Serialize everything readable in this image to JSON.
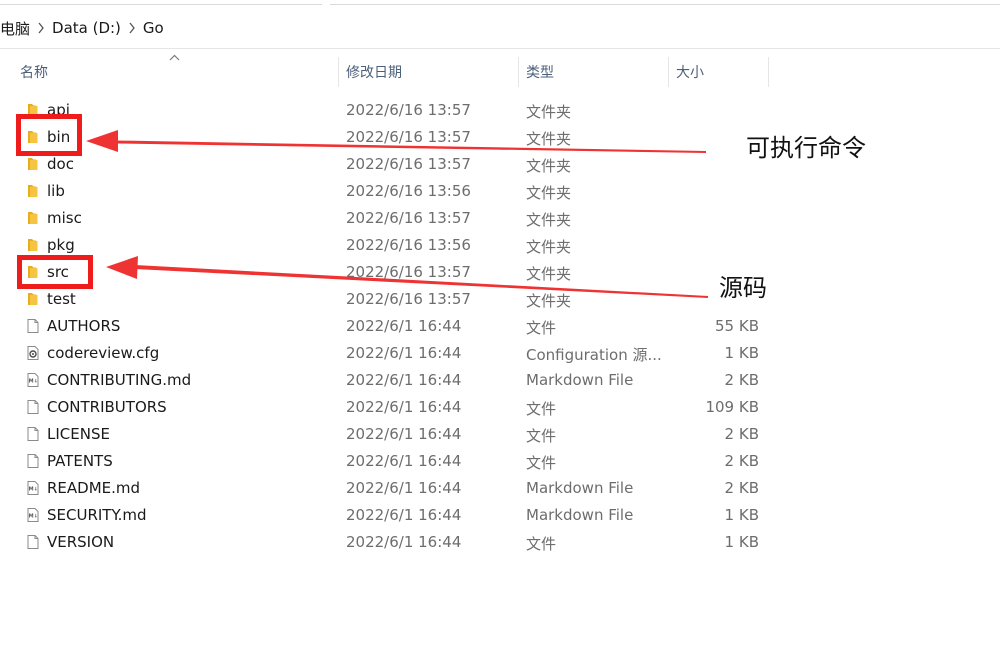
{
  "breadcrumb": {
    "items": [
      "电脑",
      "Data (D:)",
      "Go"
    ]
  },
  "columns": {
    "name": "名称",
    "modified": "修改日期",
    "type": "类型",
    "size": "大小"
  },
  "files": [
    {
      "name": "api",
      "date": "2022/6/16 13:57",
      "type": "文件夹",
      "size": "",
      "icon": "folder-icon"
    },
    {
      "name": "bin",
      "date": "2022/6/16 13:57",
      "type": "文件夹",
      "size": "",
      "icon": "folder-icon"
    },
    {
      "name": "doc",
      "date": "2022/6/16 13:57",
      "type": "文件夹",
      "size": "",
      "icon": "folder-icon"
    },
    {
      "name": "lib",
      "date": "2022/6/16 13:56",
      "type": "文件夹",
      "size": "",
      "icon": "folder-icon"
    },
    {
      "name": "misc",
      "date": "2022/6/16 13:57",
      "type": "文件夹",
      "size": "",
      "icon": "folder-icon"
    },
    {
      "name": "pkg",
      "date": "2022/6/16 13:56",
      "type": "文件夹",
      "size": "",
      "icon": "folder-icon"
    },
    {
      "name": "src",
      "date": "2022/6/16 13:57",
      "type": "文件夹",
      "size": "",
      "icon": "folder-icon"
    },
    {
      "name": "test",
      "date": "2022/6/16 13:57",
      "type": "文件夹",
      "size": "",
      "icon": "folder-icon"
    },
    {
      "name": "AUTHORS",
      "date": "2022/6/1 16:44",
      "type": "文件",
      "size": "55 KB",
      "icon": "file-icon"
    },
    {
      "name": "codereview.cfg",
      "date": "2022/6/1 16:44",
      "type": "Configuration 源...",
      "size": "1 KB",
      "icon": "config-file-icon"
    },
    {
      "name": "CONTRIBUTING.md",
      "date": "2022/6/1 16:44",
      "type": "Markdown File",
      "size": "2 KB",
      "icon": "markdown-file-icon"
    },
    {
      "name": "CONTRIBUTORS",
      "date": "2022/6/1 16:44",
      "type": "文件",
      "size": "109 KB",
      "icon": "file-icon"
    },
    {
      "name": "LICENSE",
      "date": "2022/6/1 16:44",
      "type": "文件",
      "size": "2 KB",
      "icon": "file-icon"
    },
    {
      "name": "PATENTS",
      "date": "2022/6/1 16:44",
      "type": "文件",
      "size": "2 KB",
      "icon": "file-icon"
    },
    {
      "name": "README.md",
      "date": "2022/6/1 16:44",
      "type": "Markdown File",
      "size": "2 KB",
      "icon": "markdown-file-icon"
    },
    {
      "name": "SECURITY.md",
      "date": "2022/6/1 16:44",
      "type": "Markdown File",
      "size": "1 KB",
      "icon": "markdown-file-icon"
    },
    {
      "name": "VERSION",
      "date": "2022/6/1 16:44",
      "type": "文件",
      "size": "1 KB",
      "icon": "file-icon"
    }
  ],
  "annotations": {
    "bin_label": "可执行命令",
    "src_label": "源码",
    "color": "#ef1c1c"
  },
  "colors": {
    "folder": "#f5c542",
    "header_text": "#4c607a",
    "secondary_text": "#6d6d6d"
  }
}
